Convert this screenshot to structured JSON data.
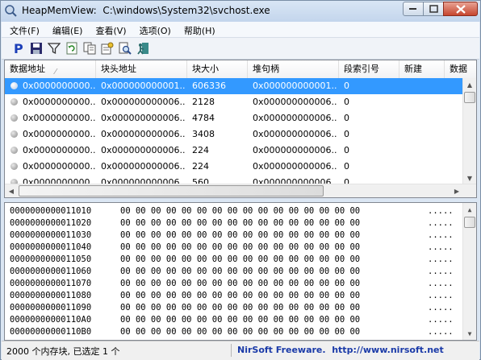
{
  "window": {
    "app_name": "HeapMemView:",
    "process_path": "C:\\windows\\System32\\svchost.exe"
  },
  "menu": [
    {
      "label": "文件(F)"
    },
    {
      "label": "编辑(E)"
    },
    {
      "label": "查看(V)"
    },
    {
      "label": "选项(O)"
    },
    {
      "label": "帮助(H)"
    }
  ],
  "toolbar": {
    "icons": [
      "process-p-icon",
      "save-icon",
      "filter-icon",
      "refresh-icon",
      "copy-icon",
      "properties-icon",
      "find-icon",
      "exit-icon"
    ],
    "accent": "#1c3fb8"
  },
  "list": {
    "columns": [
      "数据地址",
      "块头地址",
      "块大小",
      "堆句柄",
      "段索引号",
      "新建",
      "数据"
    ],
    "rows": [
      {
        "data_addr": "0x0000000000...",
        "header_addr": "0x000000000001...",
        "size": "606336",
        "heap": "0x000000000001...",
        "segment": "0",
        "selected": true
      },
      {
        "data_addr": "0x0000000000...",
        "header_addr": "0x000000000006...",
        "size": "2128",
        "heap": "0x000000000006...",
        "segment": "0",
        "selected": false
      },
      {
        "data_addr": "0x0000000000...",
        "header_addr": "0x000000000006...",
        "size": "4784",
        "heap": "0x000000000006...",
        "segment": "0",
        "selected": false
      },
      {
        "data_addr": "0x0000000000...",
        "header_addr": "0x000000000006...",
        "size": "3408",
        "heap": "0x000000000006...",
        "segment": "0",
        "selected": false
      },
      {
        "data_addr": "0x0000000000...",
        "header_addr": "0x000000000006...",
        "size": "224",
        "heap": "0x000000000006...",
        "segment": "0",
        "selected": false
      },
      {
        "data_addr": "0x0000000000...",
        "header_addr": "0x000000000006...",
        "size": "224",
        "heap": "0x000000000006...",
        "segment": "0",
        "selected": false
      },
      {
        "data_addr": "0x0000000000...",
        "header_addr": "0x000000000006...",
        "size": "560",
        "heap": "0x000000000006...",
        "segment": "0",
        "selected": false
      }
    ],
    "selection_color": "#3399ff"
  },
  "hex": {
    "lines": [
      {
        "addr": "0000000000011010",
        "bytes": "00 00 00 00 00 00 00 00 00 00 00 00 00 00 00 00",
        "ascii": "....."
      },
      {
        "addr": "0000000000011020",
        "bytes": "00 00 00 00 00 00 00 00 00 00 00 00 00 00 00 00",
        "ascii": "....."
      },
      {
        "addr": "0000000000011030",
        "bytes": "00 00 00 00 00 00 00 00 00 00 00 00 00 00 00 00",
        "ascii": "....."
      },
      {
        "addr": "0000000000011040",
        "bytes": "00 00 00 00 00 00 00 00 00 00 00 00 00 00 00 00",
        "ascii": "....."
      },
      {
        "addr": "0000000000011050",
        "bytes": "00 00 00 00 00 00 00 00 00 00 00 00 00 00 00 00",
        "ascii": "....."
      },
      {
        "addr": "0000000000011060",
        "bytes": "00 00 00 00 00 00 00 00 00 00 00 00 00 00 00 00",
        "ascii": "....."
      },
      {
        "addr": "0000000000011070",
        "bytes": "00 00 00 00 00 00 00 00 00 00 00 00 00 00 00 00",
        "ascii": "....."
      },
      {
        "addr": "0000000000011080",
        "bytes": "00 00 00 00 00 00 00 00 00 00 00 00 00 00 00 00",
        "ascii": "....."
      },
      {
        "addr": "0000000000011090",
        "bytes": "00 00 00 00 00 00 00 00 00 00 00 00 00 00 00 00",
        "ascii": "....."
      },
      {
        "addr": "00000000000110A0",
        "bytes": "00 00 00 00 00 00 00 00 00 00 00 00 00 00 00 00",
        "ascii": "....."
      },
      {
        "addr": "00000000000110B0",
        "bytes": "00 00 00 00 00 00 00 00 00 00 00 00 00 00 00 00",
        "ascii": "....."
      }
    ]
  },
  "status": {
    "count_text": "2000 个内存块, 已选定 1 个",
    "credit_text": "NirSoft Freeware.  http://www.nirsoft.net"
  }
}
